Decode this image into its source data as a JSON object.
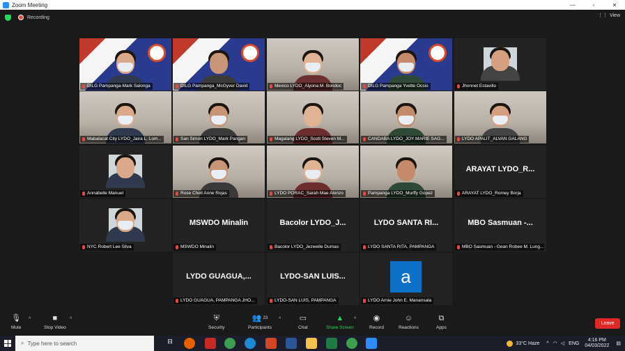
{
  "window": {
    "title": "Zoom Meeting"
  },
  "topbar": {
    "recording_label": "Recording",
    "view_label": "View"
  },
  "participants": [
    {
      "name": "DILG Pampanga-Mark Salonga",
      "big": "",
      "bg": "dilg"
    },
    {
      "name": "DILG Pampanga_McGyver David",
      "big": "",
      "bg": "dilg",
      "active": true
    },
    {
      "name": "Mexico LYDO_Alyona M. Bondoc",
      "big": "",
      "bg": "room"
    },
    {
      "name": "DILG Pampanga Yvette Ocsio",
      "big": "",
      "bg": "dilg"
    },
    {
      "name": "Jhonnet Estavillo",
      "big": "",
      "bg": "small"
    },
    {
      "name": "Mabalacat City LYDO_Jaira L. Lom...",
      "big": "",
      "bg": "room"
    },
    {
      "name": "San Simon LYDO_Mark Pangan",
      "big": "",
      "bg": "room"
    },
    {
      "name": "Magalang LYDO_Scott Steven M...",
      "big": "",
      "bg": "room"
    },
    {
      "name": "CANDABA LYDO_JOY MARIE SAG...",
      "big": "",
      "bg": "room"
    },
    {
      "name": "LYDO APALIT_ALVAN GALANG",
      "big": "",
      "bg": "room"
    },
    {
      "name": "Annabelle Manuel",
      "big": "",
      "bg": "small"
    },
    {
      "name": "Rose Chell Anne Rojas",
      "big": "",
      "bg": "room"
    },
    {
      "name": "LYDO PORAC_Sarah Mae Alonzo",
      "big": "",
      "bg": "room"
    },
    {
      "name": "Pampanga LYDO_Murffy Gopez",
      "big": "",
      "bg": "room"
    },
    {
      "name": "ARAYAT LYDO_Romey Borja",
      "big": "ARAYAT LYDO_R...",
      "bg": "none"
    },
    {
      "name": "NYC Robert Lee Silva",
      "big": "",
      "bg": "small"
    },
    {
      "name": "MSWDO Minalin",
      "big": "MSWDO Minalin",
      "bg": "none"
    },
    {
      "name": "Bacolor LYDO_Jezwelle Dumas",
      "big": "Bacolor LYDO_J...",
      "bg": "none"
    },
    {
      "name": "LYDO SANTA RITA, PAMPANGA",
      "big": "LYDO SANTA RI...",
      "bg": "none"
    },
    {
      "name": "MBO Sasmuan - Gean Robee M. Lung...",
      "big": "MBO Sasmuan -...",
      "bg": "none"
    },
    {
      "name": "LYDO GUAGUA, PAMPANGA JHO...",
      "big": "LYDO GUAGUA,...",
      "bg": "none"
    },
    {
      "name": "LYDO-SAN LUIS, PAMPANGA",
      "big": "LYDO-SAN LUIS...",
      "bg": "none"
    },
    {
      "name": "LYDO Arnie John E. Manansala",
      "big": "",
      "bg": "avatar",
      "avatar": "a"
    }
  ],
  "toolbar": {
    "mute": "Mute",
    "stop_video": "Stop Video",
    "security": "Security",
    "participants": "Participants",
    "participants_count": "23",
    "chat": "Chat",
    "share": "Share Screen",
    "record": "Record",
    "reactions": "Reactions",
    "apps": "Apps",
    "leave": "Leave"
  },
  "taskbar": {
    "search_placeholder": "Type here to search",
    "weather": "33°C  Haze",
    "lang": "ENG",
    "time": "4:16 PM",
    "date": "04/03/2022"
  },
  "colors": {
    "active_border": "#b3d233",
    "leave": "#e02828",
    "share": "#23d959",
    "accent": "#2d8cff"
  }
}
